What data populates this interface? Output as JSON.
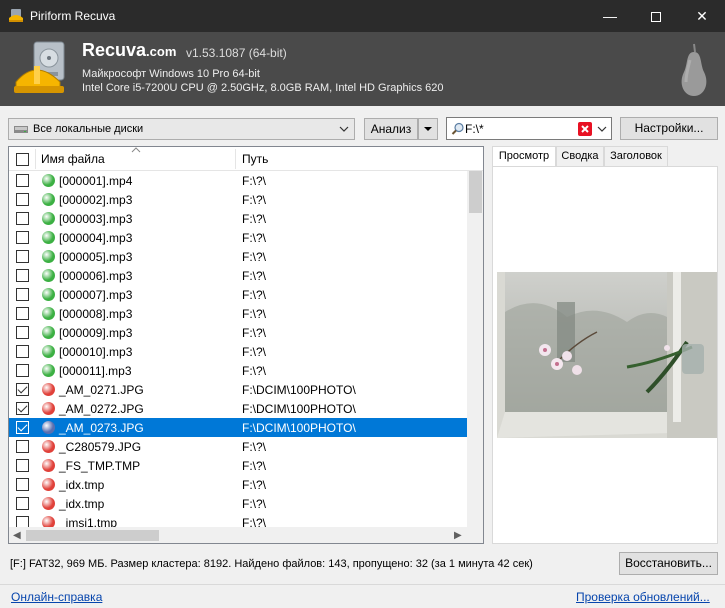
{
  "window": {
    "title": "Piriform Recuva",
    "minimize": "—",
    "close": "✕"
  },
  "header": {
    "brand": "Recuva",
    "brand_suffix": ".com",
    "version": "v1.53.1087 (64-bit)",
    "os": "Майкрософт Windows 10 Pro 64-bit",
    "cpu": "Intel Core i5-7200U CPU @ 2.50GHz, 8.0GB RAM, Intel HD Graphics 620"
  },
  "toolbar": {
    "drive_label": "Все локальные диски",
    "scan_label": "Анализ",
    "filter_value": "F:\\*",
    "options_label": "Настройки..."
  },
  "table": {
    "col_name": "Имя файла",
    "col_path": "Путь",
    "rows": [
      {
        "name": "[000001].mp4",
        "path": "F:\\?\\",
        "state": "green",
        "checked": false
      },
      {
        "name": "[000002].mp3",
        "path": "F:\\?\\",
        "state": "green",
        "checked": false
      },
      {
        "name": "[000003].mp3",
        "path": "F:\\?\\",
        "state": "green",
        "checked": false
      },
      {
        "name": "[000004].mp3",
        "path": "F:\\?\\",
        "state": "green",
        "checked": false
      },
      {
        "name": "[000005].mp3",
        "path": "F:\\?\\",
        "state": "green",
        "checked": false
      },
      {
        "name": "[000006].mp3",
        "path": "F:\\?\\",
        "state": "green",
        "checked": false
      },
      {
        "name": "[000007].mp3",
        "path": "F:\\?\\",
        "state": "green",
        "checked": false
      },
      {
        "name": "[000008].mp3",
        "path": "F:\\?\\",
        "state": "green",
        "checked": false
      },
      {
        "name": "[000009].mp3",
        "path": "F:\\?\\",
        "state": "green",
        "checked": false
      },
      {
        "name": "[000010].mp3",
        "path": "F:\\?\\",
        "state": "green",
        "checked": false
      },
      {
        "name": "[000011].mp3",
        "path": "F:\\?\\",
        "state": "green",
        "checked": false
      },
      {
        "name": "_AM_0271.JPG",
        "path": "F:\\DCIM\\100PHOTO\\",
        "state": "red",
        "checked": true
      },
      {
        "name": "_AM_0272.JPG",
        "path": "F:\\DCIM\\100PHOTO\\",
        "state": "red",
        "checked": true
      },
      {
        "name": "_AM_0273.JPG",
        "path": "F:\\DCIM\\100PHOTO\\",
        "state": "blue",
        "checked": true,
        "selected": true
      },
      {
        "name": "_C280579.JPG",
        "path": "F:\\?\\",
        "state": "red",
        "checked": false
      },
      {
        "name": "_FS_TMP.TMP",
        "path": "F:\\?\\",
        "state": "red",
        "checked": false
      },
      {
        "name": "_idx.tmp",
        "path": "F:\\?\\",
        "state": "red",
        "checked": false
      },
      {
        "name": "_idx.tmp",
        "path": "F:\\?\\",
        "state": "red",
        "checked": false
      },
      {
        "name": "_imsi1.tmp",
        "path": "F:\\?\\",
        "state": "red",
        "checked": false
      }
    ]
  },
  "preview": {
    "tabs": [
      "Просмотр",
      "Сводка",
      "Заголовок"
    ],
    "active_tab": 0
  },
  "footer": {
    "status": "[F:] FAT32, 969 МБ. Размер кластера: 8192. Найдено файлов: 143, пропущено: 32 (за 1 минута 42 сек)",
    "recover_label": "Восстановить...",
    "help_link": "Онлайн-справка",
    "update_link": "Проверка обновлений..."
  },
  "colors": {
    "green": "#3cb043",
    "red": "#e0413a",
    "blue": "#5a6fb0",
    "selection": "#0078d7"
  }
}
